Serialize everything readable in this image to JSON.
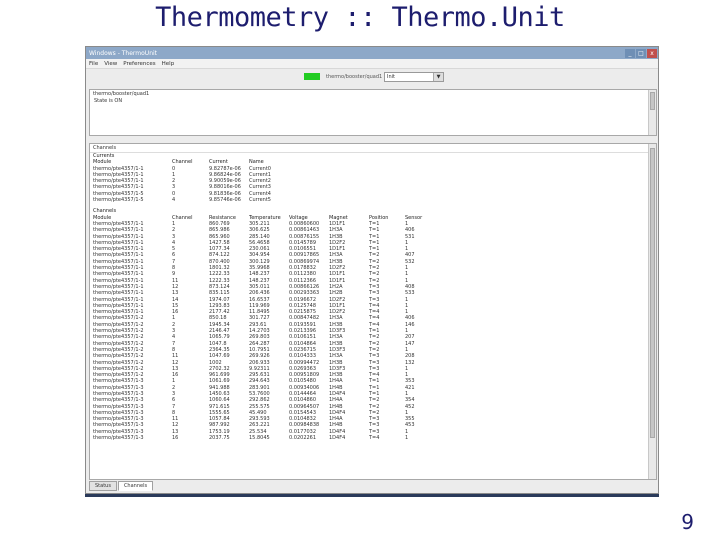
{
  "slide": {
    "title": "Thermometry :: Thermo.Unit",
    "page_number": "9"
  },
  "window": {
    "title": "Windows - ThermoUnit",
    "min": "_",
    "max": "□",
    "close": "x",
    "menu": [
      "File",
      "View",
      "Preferences",
      "Help"
    ],
    "toolbar": {
      "device_label": "thermo/booster/quad1",
      "combo_value": "Init"
    },
    "state_panel": {
      "title": "thermo/booster/quad1",
      "text": "State is ON"
    },
    "channels_panel": {
      "title": "Channels",
      "currents_title": "Currents",
      "currents_headers": [
        "Module",
        "Channel",
        "Current",
        "Name"
      ],
      "currents_rows": [
        [
          "thermo/pte4357/1-1",
          "0",
          "9.82787e-06",
          "Current0"
        ],
        [
          "thermo/pte4357/1-1",
          "1",
          "9.86824e-06",
          "Current1"
        ],
        [
          "thermo/pte4357/1-1",
          "2",
          "9.90059e-06",
          "Current2"
        ],
        [
          "thermo/pte4357/1-1",
          "3",
          "9.88016e-06",
          "Current3"
        ],
        [
          "thermo/pte4357/1-5",
          "0",
          "9.81836e-06",
          "Current4"
        ],
        [
          "thermo/pte4357/1-5",
          "4",
          "9.85746e-06",
          "Current5"
        ]
      ],
      "channels_title": "Channels",
      "channels_headers": [
        "Module",
        "Channel",
        "Resistance",
        "Temperature",
        "Voltage",
        "Magnet",
        "Position",
        "Sensor"
      ],
      "channels_rows": [
        [
          "thermo/pte4357/1-1",
          "1",
          "860.769",
          "305.211",
          "0.00860600",
          "1D1F1",
          "T=1",
          "1"
        ],
        [
          "thermo/pte4357/1-1",
          "2",
          "865.986",
          "306.625",
          "0.00861463",
          "1H3A",
          "T=1",
          "406"
        ],
        [
          "thermo/pte4357/1-1",
          "3",
          "865.960",
          "285.140",
          "0.00876155",
          "1H3B",
          "T=1",
          "531"
        ],
        [
          "thermo/pte4357/1-1",
          "4",
          "1427.58",
          "56.4658",
          "0.0145789",
          "1D2F2",
          "T=1",
          "1"
        ],
        [
          "thermo/pte4357/1-1",
          "5",
          "1077.34",
          "230.061",
          "0.0106551",
          "1D1F1",
          "T=1",
          "1"
        ],
        [
          "thermo/pte4357/1-1",
          "6",
          "874.122",
          "304.954",
          "0.00917865",
          "1H3A",
          "T=2",
          "407"
        ],
        [
          "thermo/pte4357/1-1",
          "7",
          "870.400",
          "300.129",
          "0.00869974",
          "1H3B",
          "T=2",
          "532"
        ],
        [
          "thermo/pte4357/1-1",
          "8",
          "1801.32",
          "35.9968",
          "0.0178832",
          "1D2F2",
          "T=2",
          "1"
        ],
        [
          "thermo/pte4357/1-1",
          "9",
          "1222.33",
          "148.237",
          "0.0112380",
          "1D1F1",
          "T=2",
          "1"
        ],
        [
          "thermo/pte4357/1-1",
          "11",
          "1222.33",
          "148.237",
          "0.0112366",
          "1D1F1",
          "T=2",
          "1"
        ],
        [
          "thermo/pte4357/1-1",
          "12",
          "873.124",
          "305.011",
          "0.00866126",
          "1H2A",
          "T=3",
          "408"
        ],
        [
          "thermo/pte4357/1-1",
          "13",
          "835.115",
          "206.436",
          "0.00293363",
          "1H2B",
          "T=3",
          "533"
        ],
        [
          "thermo/pte4357/1-1",
          "14",
          "1974.07",
          "16.6537",
          "0.0196672",
          "1D2F2",
          "T=3",
          "1"
        ],
        [
          "thermo/pte4357/1-1",
          "15",
          "1293.83",
          "119.969",
          "0.0125748",
          "1D1F1",
          "T=4",
          "1"
        ],
        [
          "thermo/pte4357/1-1",
          "16",
          "2177.42",
          "11.8495",
          "0.0215875",
          "1D2F2",
          "T=4",
          "1"
        ],
        [
          "thermo/pte4357/1-2",
          "1",
          "850.18",
          "301.727",
          "0.00847482",
          "1H3A",
          "T=4",
          "406"
        ],
        [
          "thermo/pte4357/1-2",
          "2",
          "1945.34",
          "293.61",
          "0.0193591",
          "1H3B",
          "T=4",
          "146"
        ],
        [
          "thermo/pte4357/1-2",
          "3",
          "2146.47",
          "14.2703",
          "0.0213396",
          "1D3F3",
          "T=1",
          "1"
        ],
        [
          "thermo/pte4357/1-2",
          "4",
          "1065.79",
          "269.803",
          "0.0106151",
          "1H3A",
          "T=2",
          "207"
        ],
        [
          "thermo/pte4357/1-2",
          "7",
          "1047.8",
          "264.287",
          "0.0104864",
          "1H3B",
          "T=2",
          "147"
        ],
        [
          "thermo/pte4357/1-2",
          "8",
          "2364.35",
          "10.7951",
          "0.0236715",
          "1D3F3",
          "T=2",
          "1"
        ],
        [
          "thermo/pte4357/1-2",
          "11",
          "1047.69",
          "269.926",
          "0.0104333",
          "1H3A",
          "T=3",
          "208"
        ],
        [
          "thermo/pte4357/1-2",
          "12",
          "1002",
          "206.933",
          "0.00994472",
          "1H3B",
          "T=3",
          "132"
        ],
        [
          "thermo/pte4357/1-2",
          "13",
          "2702.32",
          "9.92311",
          "0.0269363",
          "1D3F3",
          "T=3",
          "1"
        ],
        [
          "thermo/pte4357/1-2",
          "16",
          "961.699",
          "295.631",
          "0.00951809",
          "1H3B",
          "T=4",
          "1"
        ],
        [
          "thermo/pte4357/1-3",
          "1",
          "1061.69",
          "294.643",
          "0.0105480",
          "1H4A",
          "T=1",
          "353"
        ],
        [
          "thermo/pte4357/1-3",
          "2",
          "941.988",
          "283.901",
          "0.00934006",
          "1H4B",
          "T=1",
          "421"
        ],
        [
          "thermo/pte4357/1-3",
          "3",
          "1450.63",
          "53.7600",
          "0.0144464",
          "1D4F4",
          "T=1",
          "1"
        ],
        [
          "thermo/pte4357/1-3",
          "6",
          "1060.64",
          "292.862",
          "0.0104860",
          "1H4A",
          "T=2",
          "354"
        ],
        [
          "thermo/pte4357/1-3",
          "7",
          "971.615",
          "255.575",
          "0.00964507",
          "1H4B",
          "T=2",
          "452"
        ],
        [
          "thermo/pte4357/1-3",
          "8",
          "1555.65",
          "45.490",
          "0.0154543",
          "1D4F4",
          "T=2",
          "1"
        ],
        [
          "thermo/pte4357/1-3",
          "11",
          "1057.84",
          "293.593",
          "0.0104832",
          "1H4A",
          "T=3",
          "355"
        ],
        [
          "thermo/pte4357/1-3",
          "12",
          "987.992",
          "263.221",
          "0.00984838",
          "1H4B",
          "T=3",
          "453"
        ],
        [
          "thermo/pte4357/1-3",
          "13",
          "1753.19",
          "25.534",
          "0.0177032",
          "1D4F4",
          "T=3",
          "1"
        ],
        [
          "thermo/pte4357/1-3",
          "16",
          "2037.75",
          "15.8045",
          "0.0202261",
          "1D4F4",
          "T=4",
          "1"
        ]
      ]
    },
    "tabs": [
      "Status",
      "Channels"
    ],
    "colors": {
      "led": "#22cc22",
      "titlebar": "#8da8c8",
      "slide_title": "#1d1d6e"
    }
  }
}
